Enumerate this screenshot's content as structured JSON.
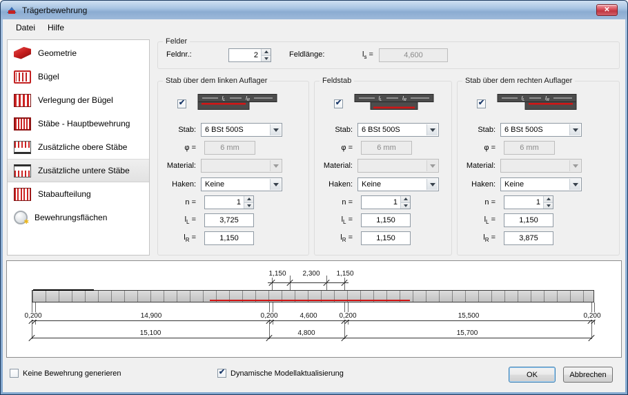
{
  "window": {
    "title": "Trägerbewehrung"
  },
  "icons": {
    "close": "✕",
    "check": "✔",
    "star": "✱"
  },
  "menu": {
    "items": [
      {
        "label": "Datei"
      },
      {
        "label": "Hilfe"
      }
    ]
  },
  "sidebar": {
    "items": [
      {
        "label": "Geometrie"
      },
      {
        "label": "Bügel"
      },
      {
        "label": "Verlegung der Bügel"
      },
      {
        "label": "Stäbe - Hauptbewehrung"
      },
      {
        "label": "Zusätzliche obere Stäbe"
      },
      {
        "label": "Zusätzliche untere Stäbe",
        "selected": true
      },
      {
        "label": "Stabaufteilung"
      },
      {
        "label": "Bewehrungsflächen"
      }
    ]
  },
  "felder": {
    "title": "Felder",
    "feldnr_label": "Feldnr.:",
    "feldnr_value": "2",
    "feldlaenge_label": "Feldlänge:",
    "l_base": "l",
    "l_sub": "s",
    "eq": "=",
    "value": "4,600"
  },
  "row_labels": {
    "stab": "Stab:",
    "phi": "φ =",
    "material": "Material:",
    "haken": "Haken:",
    "n": "n =",
    "l_base": "l",
    "sub_L": "L",
    "sub_R": "R",
    "eq": "="
  },
  "columns": [
    {
      "title": "Stab über dem linken Auflager",
      "checked": true,
      "stab": "6 BSt 500S",
      "phi": "6 mm",
      "material": "",
      "haken": "Keine",
      "n": "1",
      "lL": "3,725",
      "lR": "1,150"
    },
    {
      "title": "Feldstab",
      "checked": true,
      "stab": "6 BSt 500S",
      "phi": "6 mm",
      "material": "",
      "haken": "Keine",
      "n": "1",
      "lL": "1,150",
      "lR": "1,150"
    },
    {
      "title": "Stab über dem rechten Auflager",
      "checked": true,
      "stab": "6 BSt 500S",
      "phi": "6 mm",
      "material": "",
      "haken": "Keine",
      "n": "1",
      "lL": "1,150",
      "lR": "3,875"
    }
  ],
  "beam_diagram": {
    "top_dims": [
      "1,150",
      "2,300",
      "1,150"
    ],
    "span_dims": [
      "0,200",
      "14,900",
      "0,200",
      "4,600",
      "0,200",
      "15,500",
      "0,200"
    ],
    "total_dims": [
      "15,100",
      "4,800",
      "15,700"
    ]
  },
  "footer": {
    "generate_checkbox_label": "Keine Bewehrung generieren",
    "generate_checked": false,
    "dynamic_checkbox_label": "Dynamische Modellaktualisierung",
    "dynamic_checked": true,
    "ok_label": "OK",
    "cancel_label": "Abbrechen"
  }
}
